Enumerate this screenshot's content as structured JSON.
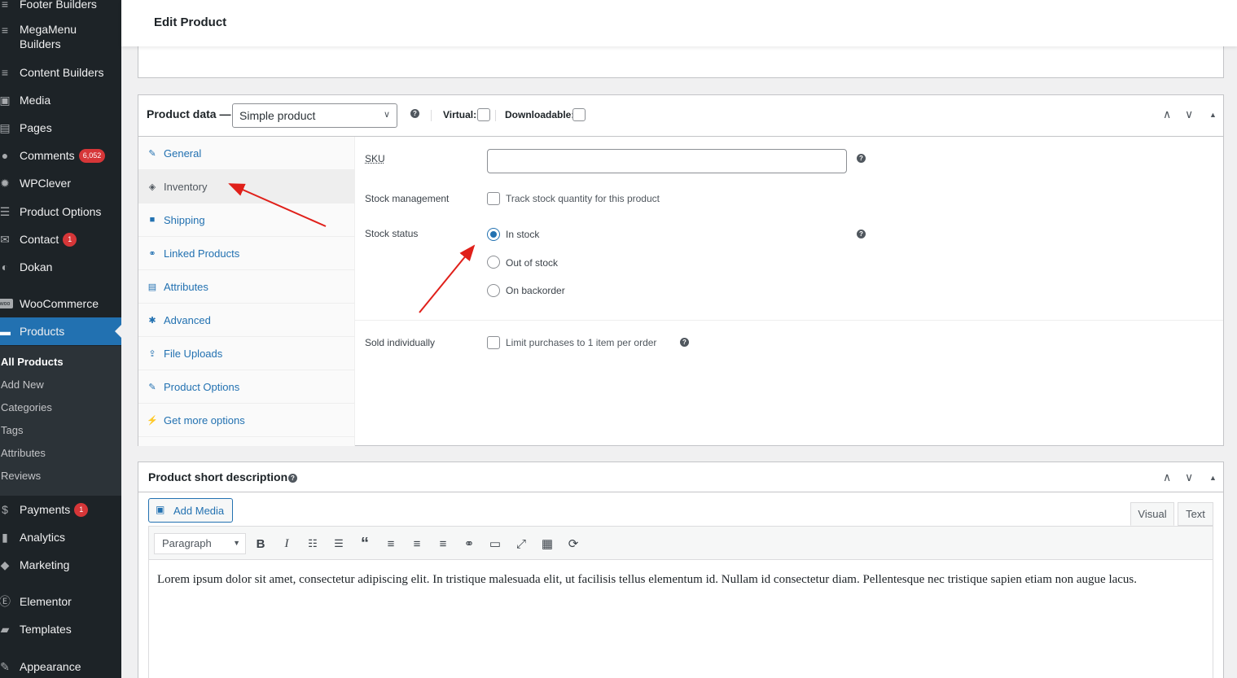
{
  "sidebar": {
    "items": [
      {
        "label": "Footer Builders",
        "icon": "menu-lines-icon"
      },
      {
        "label_line1": "MegaMenu",
        "label_line2": "Builders",
        "icon": "menu-lines-icon"
      },
      {
        "label": "Content Builders",
        "icon": "menu-lines-icon"
      },
      {
        "label": "Media",
        "icon": "media-icon"
      },
      {
        "label": "Pages",
        "icon": "pages-icon"
      },
      {
        "label": "Comments",
        "badge": "6,052",
        "icon": "comments-icon"
      },
      {
        "label": "WPClever",
        "icon": "bulb-icon"
      },
      {
        "label": "Product Options",
        "icon": "list-icon"
      },
      {
        "label": "Contact",
        "badge": "1",
        "icon": "mail-icon"
      },
      {
        "label": "Dokan",
        "icon": "dokan-icon"
      },
      {
        "label": "WooCommerce",
        "icon": "woo-icon"
      },
      {
        "label": "Products",
        "icon": "products-icon"
      },
      {
        "label": "Payments",
        "badge": "1",
        "icon": "dollar-icon"
      },
      {
        "label": "Analytics",
        "icon": "chart-icon"
      },
      {
        "label": "Marketing",
        "icon": "megaphone-icon"
      },
      {
        "label": "Elementor",
        "icon": "elementor-icon"
      },
      {
        "label": "Templates",
        "icon": "folder-icon"
      },
      {
        "label": "Appearance",
        "icon": "brush-icon"
      }
    ],
    "submenu": [
      "All Products",
      "Add New",
      "Categories",
      "Tags",
      "Attributes",
      "Reviews"
    ]
  },
  "header": {
    "title": "Edit Product"
  },
  "product_data": {
    "title": "Product data —",
    "type_selected": "Simple product",
    "virtual_label": "Virtual:",
    "downloadable_label": "Downloadable:",
    "tabs": [
      "General",
      "Inventory",
      "Shipping",
      "Linked Products",
      "Attributes",
      "Advanced",
      "File Uploads",
      "Product Options",
      "Get more options"
    ],
    "active_tab": "Inventory",
    "fields": {
      "sku_label": "SKU",
      "stock_mgmt_label": "Stock management",
      "stock_mgmt_option": "Track stock quantity for this product",
      "stock_status_label": "Stock status",
      "stock_status_options": [
        "In stock",
        "Out of stock",
        "On backorder"
      ],
      "stock_status_selected": "In stock",
      "sold_individually_label": "Sold individually",
      "sold_individually_option": "Limit purchases to 1 item per order"
    }
  },
  "short_description": {
    "title": "Product short description",
    "add_media": "Add Media",
    "tab_visual": "Visual",
    "tab_text": "Text",
    "format": "Paragraph",
    "content": "Lorem ipsum dolor sit amet, consectetur adipiscing elit. In tristique malesuada elit, ut facilisis tellus elementum id. Nullam id consectetur diam. Pellentesque nec tristique sapien etiam non augue lacus."
  },
  "colors": {
    "sidebar_bg": "#1d2327",
    "accent": "#2271b1",
    "badge": "#d63638",
    "annotation_arrow": "#e0201a"
  }
}
